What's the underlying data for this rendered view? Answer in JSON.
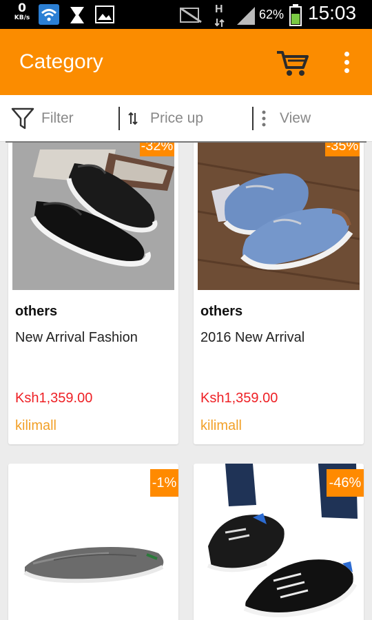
{
  "status_bar": {
    "speed_value": "0",
    "speed_unit": "KB/s",
    "network_type": "H",
    "battery_percent": "62%",
    "time": "15:03"
  },
  "app_bar": {
    "title": "Category",
    "cart_icon": "cart-icon",
    "more_icon": "more-vert-icon"
  },
  "filter_bar": {
    "filter_label": "Filter",
    "price_label": "Price up",
    "view_label": "View"
  },
  "products": [
    {
      "discount": "-32%",
      "brand": "others",
      "name": "New Arrival Fashion",
      "price": "Ksh1,359.00",
      "store": "kilimall"
    },
    {
      "discount": "-35%",
      "brand": "others",
      "name": "2016 New Arrival",
      "price": "Ksh1,359.00",
      "store": "kilimall"
    },
    {
      "discount": "-1%",
      "brand": "",
      "name": "",
      "price": "",
      "store": ""
    },
    {
      "discount": "-46%",
      "brand": "",
      "name": "",
      "price": "",
      "store": ""
    }
  ],
  "colors": {
    "accent": "#fb8c00",
    "badge": "#ff8a00",
    "price": "#ee1f24",
    "store": "#f2a027"
  }
}
